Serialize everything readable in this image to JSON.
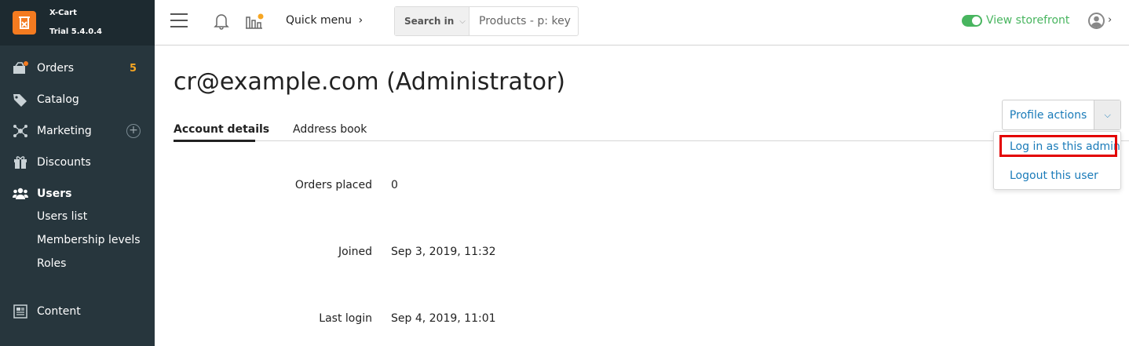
{
  "brand": {
    "name": "X-Cart",
    "version": "Trial 5.4.0.4"
  },
  "sidebar": {
    "items": [
      {
        "label": "Orders",
        "badge": "5",
        "icon": "orders-icon"
      },
      {
        "label": "Catalog",
        "icon": "tag-icon"
      },
      {
        "label": "Marketing",
        "icon": "marketing-icon"
      },
      {
        "label": "Discounts",
        "icon": "gift-icon"
      },
      {
        "label": "Users",
        "icon": "users-icon"
      },
      {
        "label": "Content",
        "icon": "content-icon"
      }
    ],
    "users_sub": [
      "Users list",
      "Membership levels",
      "Roles"
    ]
  },
  "header": {
    "quick_menu": "Quick menu",
    "search_in": "Search in",
    "search_placeholder": "Products - p: key",
    "view_storefront": "View storefront"
  },
  "page": {
    "title": "cr@example.com (Administrator)",
    "tabs": [
      "Account details",
      "Address book"
    ],
    "profile_actions": "Profile actions",
    "dropdown": [
      "Log in as this admin",
      "Logout this user"
    ],
    "rows": [
      {
        "label": "Orders placed",
        "value": "0"
      },
      {
        "label": "Joined",
        "value": "Sep 3, 2019, 11:32"
      },
      {
        "label": "Last login",
        "value": "Sep 4, 2019, 11:01"
      }
    ]
  },
  "colors": {
    "sidebar_bg": "#27363d",
    "brand_orange": "#f47b20",
    "badge": "#f6a623",
    "link_blue": "#1a7bb9",
    "storefront_green": "#48b55f",
    "highlight_red": "#e30000"
  }
}
